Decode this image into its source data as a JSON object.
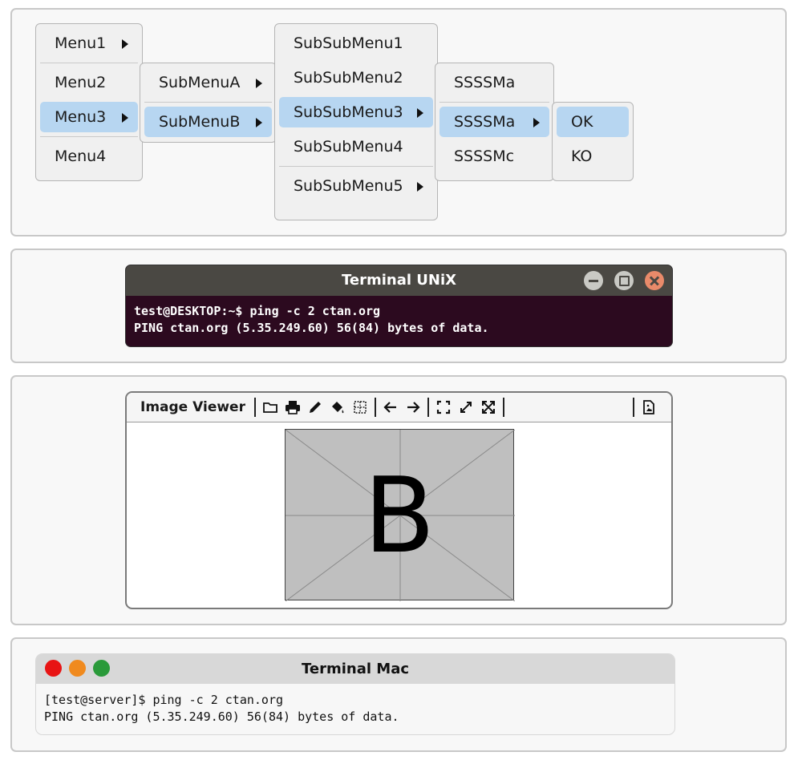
{
  "menus": {
    "level1": [
      {
        "label": "Menu1",
        "arrow": true,
        "selected": false
      },
      {
        "label": "Menu2",
        "arrow": false,
        "selected": false
      },
      {
        "label": "Menu3",
        "arrow": true,
        "selected": true
      },
      {
        "label": "Menu4",
        "arrow": false,
        "selected": false
      }
    ],
    "level2": [
      {
        "label": "SubMenuA",
        "arrow": true,
        "selected": false
      },
      {
        "label": "SubMenuB",
        "arrow": true,
        "selected": true
      }
    ],
    "level3": [
      {
        "label": "SubSubMenu1",
        "arrow": false,
        "selected": false
      },
      {
        "label": "SubSubMenu2",
        "arrow": false,
        "selected": false
      },
      {
        "label": "SubSubMenu3",
        "arrow": true,
        "selected": true
      },
      {
        "label": "SubSubMenu4",
        "arrow": false,
        "selected": false
      },
      {
        "label": "SubSubMenu5",
        "arrow": true,
        "selected": false
      }
    ],
    "level4": [
      {
        "label": "SSSSMa",
        "arrow": false,
        "selected": false
      },
      {
        "label": "SSSSMa",
        "arrow": true,
        "selected": true
      },
      {
        "label": "SSSSMc",
        "arrow": false,
        "selected": false
      }
    ],
    "level5": [
      {
        "label": "OK",
        "arrow": false,
        "selected": true
      },
      {
        "label": "KO",
        "arrow": false,
        "selected": false
      }
    ]
  },
  "terminal_unix": {
    "title": "Terminal UNiX",
    "lines": [
      "test@DESKTOP:~$ ping -c 2 ctan.org",
      "PING ctan.org (5.35.249.60) 56(84) bytes of data."
    ]
  },
  "image_viewer": {
    "title": "Image Viewer",
    "image_label": "B",
    "toolbar_icons": [
      "folder-icon",
      "print-icon",
      "pencil-icon",
      "paint-bucket-icon",
      "grid-icon",
      "arrow-left-icon",
      "arrow-right-icon",
      "fit-screen-icon",
      "expand-icon",
      "fullscreen-icon",
      "image-file-icon"
    ]
  },
  "terminal_mac": {
    "title": "Terminal Mac",
    "lines": [
      "[test@server]$ ping -c 2 ctan.org",
      "PING ctan.org (5.35.249.60) 56(84) bytes of data."
    ]
  },
  "colors": {
    "menu_selected": "#b7d6f1",
    "unix_titlebar": "#4a4843",
    "unix_bg": "#2c0a1f",
    "unix_close": "#e98a6a",
    "mac_red": "#e81414",
    "mac_orange": "#f08a1e",
    "mac_green": "#2a9a3a"
  }
}
